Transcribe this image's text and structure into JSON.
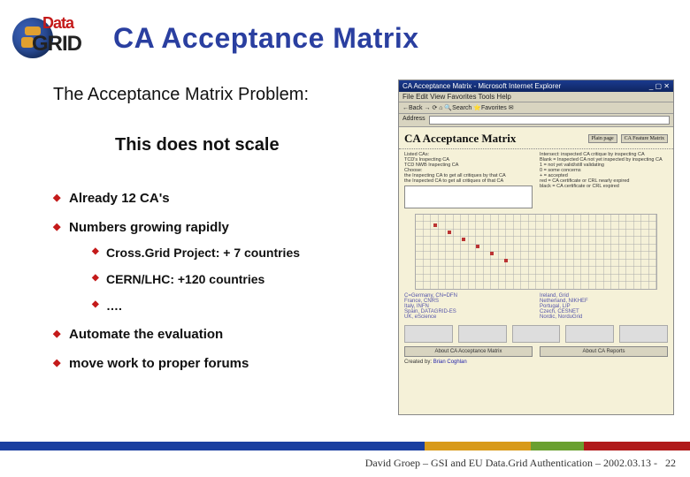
{
  "logo": {
    "top": "Data",
    "bottom": "GRID"
  },
  "title": "CA Acceptance Matrix",
  "subtitle": "The Acceptance Matrix Problem:",
  "scale_line": "This does not scale",
  "bullets": {
    "b1": "Already 12 CA's",
    "b2": "Numbers growing rapidly",
    "b2a": "Cross.Grid Project: + 7 countries",
    "b2b": "CERN/LHC: +120 countries",
    "b2c": "….",
    "b3": "Automate the evaluation",
    "b4": "move work to proper forums"
  },
  "browser": {
    "window_title": "CA Acceptance Matrix - Microsoft Internet Explorer",
    "menu": "File   Edit   View   Favorites   Tools   Help",
    "toolbar": "←Back  →  ⟳  ⌂  🔍Search  ⭐Favorites  ✉",
    "address_label": "Address",
    "page_title": "CA Acceptance Matrix",
    "btn1": "Plain page",
    "btn2": "CA Feature Matrix",
    "legend_left": "Listed CAs:\nTCD's Inspecting CA\nTCD NWB Inspecting CA\nChoose:\nthe Inspecting CA to get all critiques by that CA\nthe Inspected CA to get all critiques of that CA",
    "legend_right": "Intersect: inspected CA critique by inspecting CA\nBlank = Inspected CA not yet inspected by inspecting CA\n1 = not yet valid/still validating\n0 = some concerns\n+ = accepted\nred = CA certificate or CRL nearly expired\nblack = CA certificate or CRL expired",
    "list1": "C=Germany, CN=DFN\nFrance, CNRS\nItaly, INFN\nSpain, DATAGRID-ES\nUK, eScience",
    "list2": "Ireland, Grid\nNetherland, NIKHEF\nPortugal, LIP\nCzech, CESNET\nNordic, NorduGrid",
    "bbtn1": "About CA Acceptance Matrix",
    "bbtn2": "About CA Reports",
    "credit_label": "Created by:",
    "credit_name": "Brian Coghlan"
  },
  "footer": {
    "text": "David Groep – GSI and EU Data.Grid Authentication  – 2002.03.13  -",
    "page": "22"
  }
}
